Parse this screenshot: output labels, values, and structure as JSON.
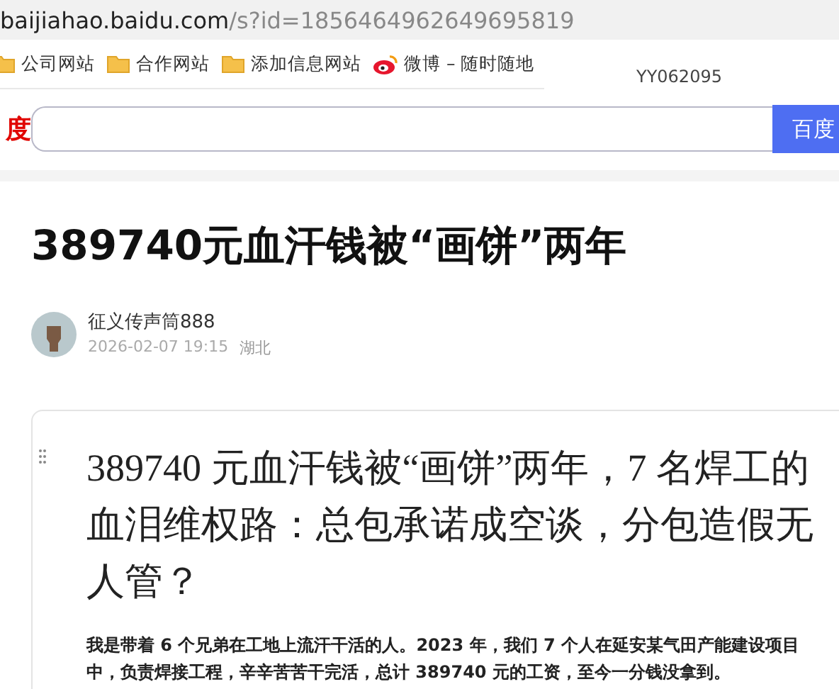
{
  "address_bar": {
    "host": "baijiahao.baidu.com",
    "path": "/s?id=1856464962649695819"
  },
  "bookmarks": [
    {
      "label": "公司网站",
      "kind": "folder"
    },
    {
      "label": "合作网站",
      "kind": "folder"
    },
    {
      "label": "添加信息网站",
      "kind": "folder"
    },
    {
      "label": "微博 – 随时随地",
      "kind": "weibo"
    }
  ],
  "overlay_label": "YY062095",
  "search": {
    "logo_fragment": "度",
    "button": "百度"
  },
  "article": {
    "title": "389740元血汗钱被“画饼”两年",
    "author": "征义传声筒888",
    "date": "2026-02-07 19:15",
    "location": "湖北"
  },
  "document": {
    "heading": "389740 元血汗钱被“画饼”两年，7 名焊工的血泪维权路：总包承诺成空谈，分包造假无人管？",
    "body": "我是带着 6 个兄弟在工地上流汗干活的人。2023 年，我们 7 个人在延安某气田产能建设项目中，负责焊接工程，辛辛苦苦干完活，总计 389740 元的工资，至今一分钱没拿到。"
  }
}
